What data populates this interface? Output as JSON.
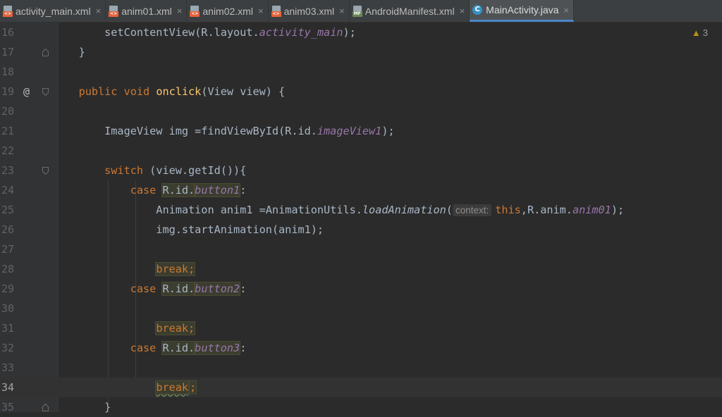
{
  "tabs": [
    {
      "label": "activity_main.xml",
      "type": "xml",
      "active": false
    },
    {
      "label": "anim01.xml",
      "type": "xml",
      "active": false
    },
    {
      "label": "anim02.xml",
      "type": "xml",
      "active": false
    },
    {
      "label": "anim03.xml",
      "type": "xml",
      "active": false
    },
    {
      "label": "AndroidManifest.xml",
      "type": "manifest",
      "active": false
    },
    {
      "label": "MainActivity.java",
      "type": "class",
      "active": true
    }
  ],
  "icons": {
    "xml_badge": "<>",
    "manifest_badge": "MF",
    "class_letter": "C",
    "close": "×",
    "warning": "▲",
    "override_marker": "@"
  },
  "warnings": {
    "count": "3"
  },
  "current_line": "34",
  "lines": [
    {
      "num": "16",
      "segments": [
        {
          "t": "        setContentView(R.layout."
        },
        {
          "t": "activity_main",
          "c": "fld"
        },
        {
          "t": ");"
        }
      ]
    },
    {
      "num": "17",
      "segments": [
        {
          "t": "    }"
        }
      ]
    },
    {
      "num": "18",
      "segments": []
    },
    {
      "num": "19",
      "segments": [
        {
          "t": "    "
        },
        {
          "t": "public void ",
          "c": "kw"
        },
        {
          "t": "onclick",
          "c": "fn"
        },
        {
          "t": "(View view) {"
        }
      ]
    },
    {
      "num": "20",
      "segments": []
    },
    {
      "num": "21",
      "segments": [
        {
          "t": "        ImageView img =findViewById(R.id."
        },
        {
          "t": "imageView1",
          "c": "fld"
        },
        {
          "t": ");"
        }
      ]
    },
    {
      "num": "22",
      "segments": []
    },
    {
      "num": "23",
      "segments": [
        {
          "t": "        "
        },
        {
          "t": "switch",
          "c": "kw"
        },
        {
          "t": " (view.getId()){"
        }
      ]
    },
    {
      "num": "24",
      "segments": [
        {
          "t": "            "
        },
        {
          "t": "case ",
          "c": "kw"
        },
        {
          "t": "R.id.",
          "c": "hl"
        },
        {
          "t": "button1",
          "c": "fld hl"
        },
        {
          "t": ":"
        }
      ]
    },
    {
      "num": "25",
      "segments": [
        {
          "t": "                Animation anim1 =AnimationUtils."
        },
        {
          "t": "loadAnimation",
          "c": "mth"
        },
        {
          "t": "("
        },
        {
          "t": "context:",
          "c": "hint"
        },
        {
          "t": "this",
          "c": "kw"
        },
        {
          "t": ",R.anim."
        },
        {
          "t": "anim01",
          "c": "fld"
        },
        {
          "t": ");"
        }
      ]
    },
    {
      "num": "26",
      "segments": [
        {
          "t": "                img.startAnimation(anim1);"
        }
      ]
    },
    {
      "num": "27",
      "segments": []
    },
    {
      "num": "28",
      "segments": [
        {
          "t": "                "
        },
        {
          "t": "break;",
          "c": "kw hl"
        }
      ]
    },
    {
      "num": "29",
      "segments": [
        {
          "t": "            "
        },
        {
          "t": "case ",
          "c": "kw"
        },
        {
          "t": "R.id.",
          "c": "hl"
        },
        {
          "t": "button2",
          "c": "fld hl"
        },
        {
          "t": ":"
        }
      ]
    },
    {
      "num": "30",
      "segments": []
    },
    {
      "num": "31",
      "segments": [
        {
          "t": "                "
        },
        {
          "t": "break;",
          "c": "kw hl"
        }
      ]
    },
    {
      "num": "32",
      "segments": [
        {
          "t": "            "
        },
        {
          "t": "case ",
          "c": "kw"
        },
        {
          "t": "R.id.",
          "c": "hl"
        },
        {
          "t": "button3",
          "c": "fld hl"
        },
        {
          "t": ":"
        }
      ]
    },
    {
      "num": "33",
      "segments": []
    },
    {
      "num": "34",
      "segments": [
        {
          "t": "                "
        },
        {
          "t": "break",
          "c": "kw hl squig"
        },
        {
          "t": "",
          "c": "caret"
        },
        {
          "t": ";",
          "c": "kw hl"
        }
      ]
    },
    {
      "num": "35",
      "segments": [
        {
          "t": "        }"
        }
      ]
    }
  ]
}
